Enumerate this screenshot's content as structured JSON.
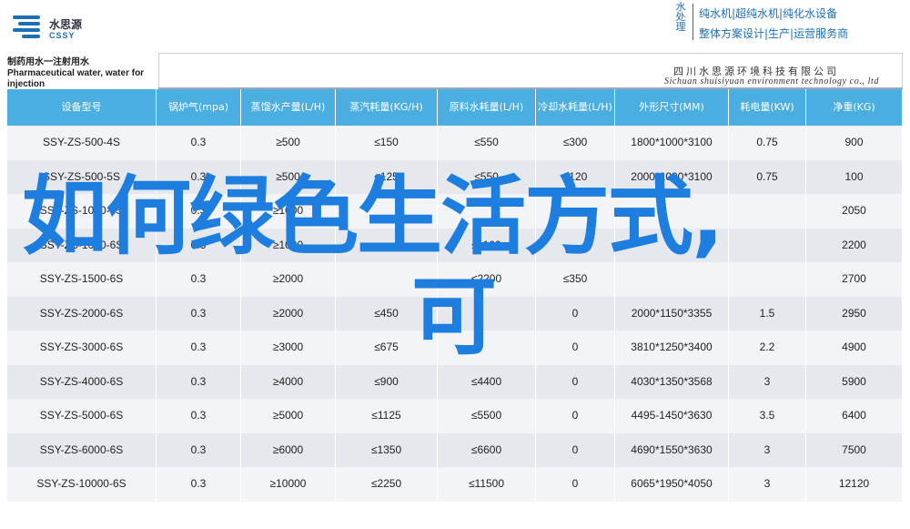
{
  "header": {
    "logo_cn": "水思源",
    "logo_en": "CSSY",
    "brand_vertical": "水处理",
    "brand_line1": "纯水机|超纯水机|纯化水设备",
    "brand_line2": "整体方案设计|生产|运营服务商",
    "brand_color": "#1b6fb6"
  },
  "document": {
    "title": "制药用水一注射用水 Pharmaceutical water, water for injection",
    "company_cn": "四川水思源环境科技有限公司",
    "company_en": "Sichuan shuisiyuan environment technology co., ltd"
  },
  "table": {
    "header_color": "#4aaee0",
    "columns": [
      "设备型号",
      "锅炉气(mpa)",
      "蒸馏水产量(L/H)",
      "蒸汽耗量(KG/H)",
      "原料水耗量(L/H)",
      "冷却水耗量(L/H)",
      "外形尺寸(MM)",
      "耗电量(KW)",
      "净重(KG)"
    ],
    "rows": [
      [
        "SSY-ZS-500-4S",
        "0.3",
        "≥500",
        "≤150",
        "≤550",
        "≤300",
        "1800*1000*3100",
        "0.75",
        "900"
      ],
      [
        "SSY-ZS-500-5S",
        "0.3",
        "≥500",
        "≤125",
        "≤550",
        "≤120",
        "2000*1000*3100",
        "0.75",
        "100"
      ],
      [
        "SSY-ZS-1000-5S",
        "0.3",
        "≥1000",
        "",
        "",
        "",
        "",
        "",
        "2050"
      ],
      [
        "SSY-ZS-1000-6S",
        "0.3",
        "≥1000",
        "",
        "≤1100",
        "",
        "",
        "",
        "2200"
      ],
      [
        "SSY-ZS-1500-6S",
        "0.3",
        "≥2000",
        "",
        "≤2200",
        "≤350",
        "",
        "",
        "2700"
      ],
      [
        "SSY-ZS-2000-6S",
        "0.3",
        "≥2000",
        "≤450",
        "",
        "0",
        "2000*1150*3355",
        "1.5",
        "2950"
      ],
      [
        "SSY-ZS-3000-6S",
        "0.3",
        "≥3000",
        "≤675",
        "",
        "0",
        "3810*1250*3400",
        "2.2",
        "4900"
      ],
      [
        "SSY-ZS-4000-6S",
        "0.3",
        "≥4000",
        "≤900",
        "≤4400",
        "0",
        "4030*1350*3568",
        "3",
        "5900"
      ],
      [
        "SSY-ZS-5000-6S",
        "0.3",
        "≥5000",
        "≤1125",
        "≤5500",
        "0",
        "4495-1450*3630",
        "3.5",
        "6400"
      ],
      [
        "SSY-ZS-6000-6S",
        "0.3",
        "≥6000",
        "≤1350",
        "≤6600",
        "0",
        "4690*1550*3630",
        "3",
        "7500"
      ],
      [
        "SSY-ZS-10000-6S",
        "0.3",
        "≥10000",
        "≤2250",
        "≤11500",
        "0",
        "6065*1950*4050",
        "3",
        "12120"
      ]
    ]
  },
  "overlay": {
    "line1": "如何绿色生活方式,",
    "line2": "可",
    "color": "#1e7ee0"
  }
}
